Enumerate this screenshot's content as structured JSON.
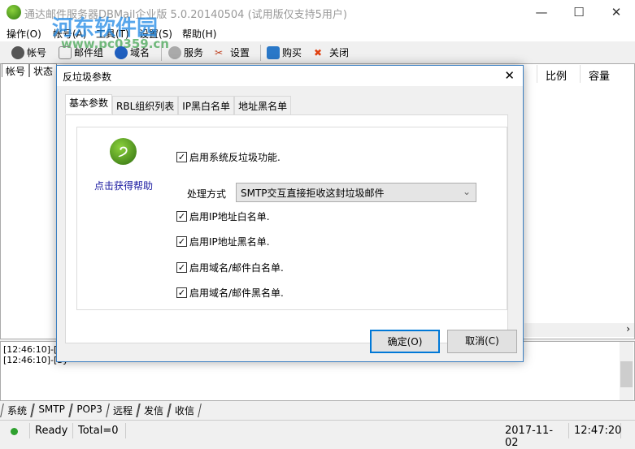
{
  "window": {
    "title": "通达邮件服务器DBMail企业版 5.0.20140504 (试用版仅支持5用户)",
    "minimize": "—",
    "maximize": "☐",
    "close": "✕"
  },
  "watermark": {
    "name": "河东软件园",
    "url": "www.pc0359.cn"
  },
  "menu": [
    "操作(O)",
    "帐号(A)",
    "工具(T)",
    "设置(S)",
    "帮助(H)"
  ],
  "toolbar": [
    {
      "label": "帐号",
      "icon": "user-icon",
      "color": "#555555"
    },
    {
      "label": "邮件组",
      "icon": "mail-group-icon",
      "color": "#888888"
    },
    {
      "label": "域名",
      "icon": "globe-icon",
      "color": "#1f5fbf"
    },
    {
      "label": "服务",
      "icon": "gear-icon",
      "color": "#999999"
    },
    {
      "label": "设置",
      "icon": "tools-icon",
      "color": "#c04020"
    },
    {
      "label": "购买",
      "icon": "basket-icon",
      "color": "#2a78c8"
    },
    {
      "label": "关闭",
      "icon": "close-icon",
      "color": "#e04010"
    }
  ],
  "main_tabs": [
    "帐号",
    "状态"
  ],
  "columns": [
    "比例",
    "容量"
  ],
  "log": [
    "[12:46:10]-[Sy",
    "[12:46:10]-[Sy"
  ],
  "bottom_tabs": [
    "系统",
    "SMTP",
    "POP3",
    "远程",
    "发信",
    "收信"
  ],
  "status": {
    "state": "Ready",
    "total": "Total=0",
    "date": "2017-11-02",
    "time": "12:47:20",
    "indicator_color": "#2ea02e"
  },
  "dialog": {
    "title": "反垃圾参数",
    "close": "✕",
    "tabs": [
      "基本参数",
      "RBL组织列表",
      "IP黑白名单",
      "地址黑名单"
    ],
    "help_link": "点击获得帮助",
    "enable_antispam": {
      "label": "启用系统反垃圾功能.",
      "checked": true
    },
    "method_label": "处理方式",
    "method_value": "SMTP交互直接拒收这封垃圾邮件",
    "options": [
      {
        "label": "启用IP地址白名单.",
        "checked": true
      },
      {
        "label": "启用IP地址黑名单.",
        "checked": true
      },
      {
        "label": "启用域名/邮件白名单.",
        "checked": true
      },
      {
        "label": "启用域名/邮件黑名单.",
        "checked": true
      }
    ],
    "ok": "确定(O)",
    "cancel": "取消(C)"
  }
}
